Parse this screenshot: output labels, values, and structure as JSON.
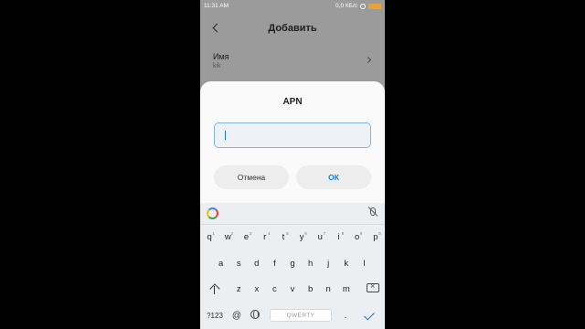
{
  "status_bar": {
    "time": "11:31 AM",
    "network": "0,0 КБ/с",
    "battery": "74"
  },
  "header": {
    "title": "Добавить"
  },
  "setting_row": {
    "label": "Имя",
    "value": "kik"
  },
  "dialog": {
    "title": "APN",
    "input_value": "",
    "cancel_label": "Отмена",
    "ok_label": "ОК"
  },
  "keyboard": {
    "row1": [
      {
        "k": "q",
        "h": "1"
      },
      {
        "k": "w",
        "h": "2"
      },
      {
        "k": "e",
        "h": "3"
      },
      {
        "k": "r",
        "h": "4"
      },
      {
        "k": "t",
        "h": "5"
      },
      {
        "k": "y",
        "h": "6"
      },
      {
        "k": "u",
        "h": "7"
      },
      {
        "k": "i",
        "h": "8"
      },
      {
        "k": "o",
        "h": "9"
      },
      {
        "k": "p",
        "h": "0"
      }
    ],
    "row2": [
      "a",
      "s",
      "d",
      "f",
      "g",
      "h",
      "j",
      "k",
      "l"
    ],
    "row3": [
      "z",
      "x",
      "c",
      "v",
      "b",
      "n",
      "m"
    ],
    "symbols_label": "?123",
    "at_label": "@",
    "space_label": "QWERTY",
    "period_label": "."
  },
  "colors": {
    "accent": "#1a7bd1",
    "dim_overlay": "#9b9b9b",
    "dialog_bg": "#fafafa"
  }
}
